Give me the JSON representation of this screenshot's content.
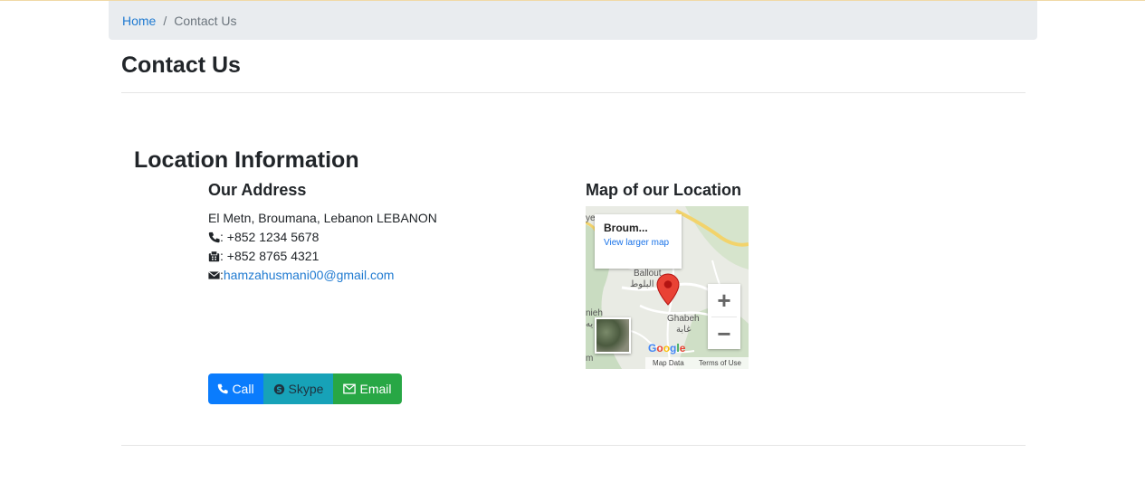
{
  "breadcrumb": {
    "home": "Home",
    "separator": "/",
    "current": "Contact Us"
  },
  "page": {
    "title": "Contact Us"
  },
  "location": {
    "section_title": "Location Information",
    "address_title": "Our Address",
    "address": "El Metn, Broumana, Lebanon LEBANON",
    "phone_suffix": ": +852 1234 5678",
    "fax_suffix": ": +852 8765 4321",
    "email_prefix": ": ",
    "email": "hamzahusmani00@gmail.com"
  },
  "buttons": {
    "call": "Call",
    "skype": "Skype",
    "email": "Email"
  },
  "map": {
    "title": "Map of our Location",
    "place_name": "Broum...",
    "view_larger": "View larger map",
    "labels": {
      "ballout": "Ballout",
      "ballout_ar": "البلوط",
      "ghabeh": "Ghabeh",
      "ghabeh_ar": "غابة",
      "left_fragment": "nieh",
      "left_fragment_ar": "يه",
      "bottom_fragment": "m",
      "top_fragment": "ye"
    },
    "zoom_in": "+",
    "zoom_out": "−",
    "logo": "Google",
    "map_data": "Map Data",
    "terms": "Terms of Use"
  },
  "colors": {
    "link": "#1f7ad1",
    "call": "#0a7cfd",
    "skype": "#17a2b8",
    "email": "#28a745",
    "breadcrumb_bg": "#e9ecef"
  },
  "icons": {
    "phone": "phone-icon",
    "fax": "fax-icon",
    "envelope": "envelope-icon",
    "skype": "skype-icon",
    "pin": "map-pin-icon"
  }
}
